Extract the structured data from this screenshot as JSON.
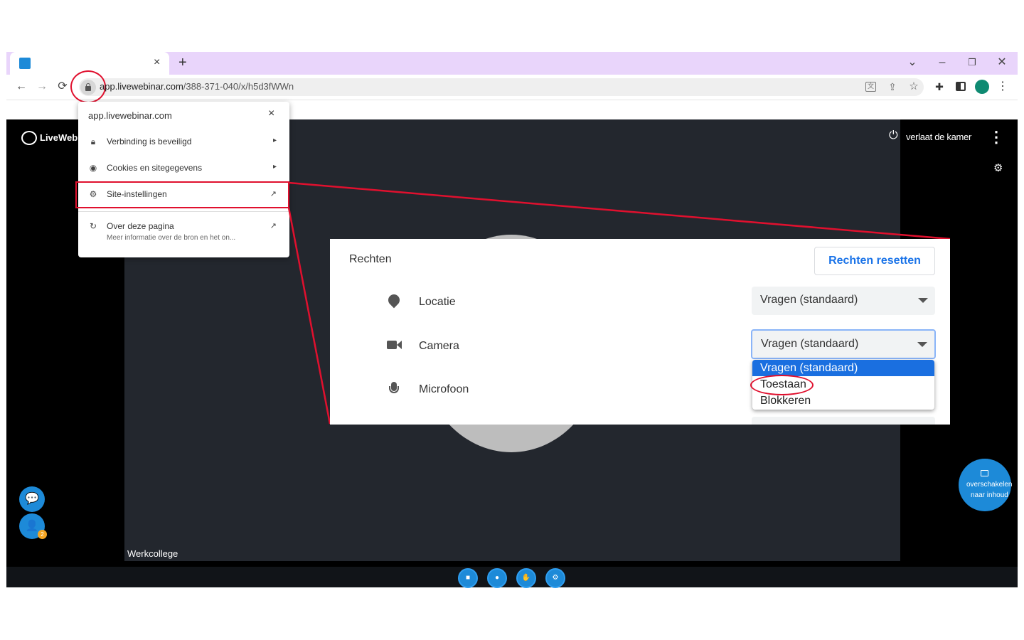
{
  "browser": {
    "new_tab_icon": "+",
    "tab_close": "×",
    "url_host": "app.livewebinar.com",
    "url_path": "/388-371-040/x/h5d3fWWn",
    "nav": {
      "back": "←",
      "forward": "→",
      "reload": "⟳"
    },
    "window": {
      "dropdown": "⌄",
      "minimize": "–",
      "restore": "❐",
      "close": "✕"
    },
    "toolbar_icons": [
      "translate-icon",
      "share-icon",
      "star-icon",
      "extensions-icon",
      "sidepanel-icon",
      "profile-icon",
      "menu-icon"
    ]
  },
  "site_popup": {
    "host": "app.livewebinar.com",
    "close": "×",
    "items": [
      {
        "icon": "lock-icon",
        "label": "Verbinding is beveiligd"
      },
      {
        "icon": "cookie-icon",
        "label": "Cookies en sitegegevens"
      },
      {
        "icon": "gear-icon",
        "label": "Site-instellingen"
      },
      {
        "icon": "info-icon",
        "label": "Over deze pagina",
        "sub": "Meer informatie over de bron en het on..."
      }
    ]
  },
  "webinar": {
    "logo_text": "LiveWeb",
    "leave_label": "verlaat de kamer",
    "room_label": "Werkcollege",
    "switch_label_1": "overschakelen",
    "switch_label_2": "naar inhoud",
    "participants_badge": "2"
  },
  "permissions": {
    "title": "Rechten",
    "reset_button": "Rechten resetten",
    "rows": [
      {
        "icon": "location-pin-icon",
        "label": "Locatie",
        "value": "Vragen (standaard)"
      },
      {
        "icon": "camera-icon",
        "label": "Camera",
        "value": "Vragen (standaard)"
      },
      {
        "icon": "microphone-icon",
        "label": "Microfoon",
        "value": ""
      }
    ],
    "options": [
      "Vragen (standaard)",
      "Toestaan",
      "Blokkeren"
    ],
    "selected_option": "Vragen (standaard)"
  },
  "colors": {
    "tabstrip": "#e9d5fb",
    "highlight": "#e0102e",
    "accent_blue": "#1a73e8",
    "app_button": "#1d8ad8",
    "profile": "#0f8a72"
  }
}
